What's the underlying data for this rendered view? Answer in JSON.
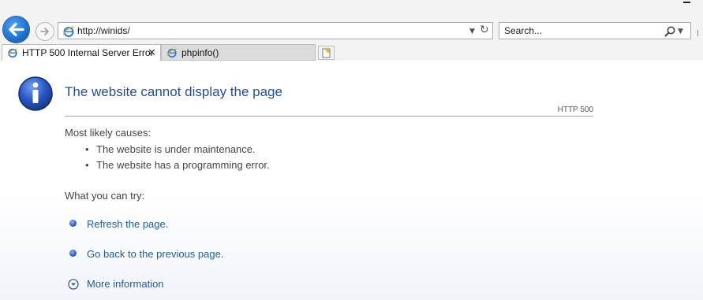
{
  "browser": {
    "address": {
      "url": "http://winids/"
    },
    "search": {
      "placeholder": "Search..."
    },
    "tabs": [
      {
        "label": "HTTP 500 Internal Server Error",
        "active": true,
        "close": "✕"
      },
      {
        "label": "phpinfo()",
        "active": false
      }
    ]
  },
  "page": {
    "title": "The website cannot display the page",
    "code": "HTTP 500",
    "causes_heading": "Most likely causes:",
    "causes": [
      "The website is under maintenance.",
      "The website has a programming error."
    ],
    "try_heading": "What you can try:",
    "actions": [
      "Refresh the page.",
      "Go back to the previous page."
    ],
    "more_info": "More information"
  },
  "colors": {
    "title": "#1f4f9d",
    "link": "#1f5d9c",
    "back_button": "#1b6fd0"
  }
}
